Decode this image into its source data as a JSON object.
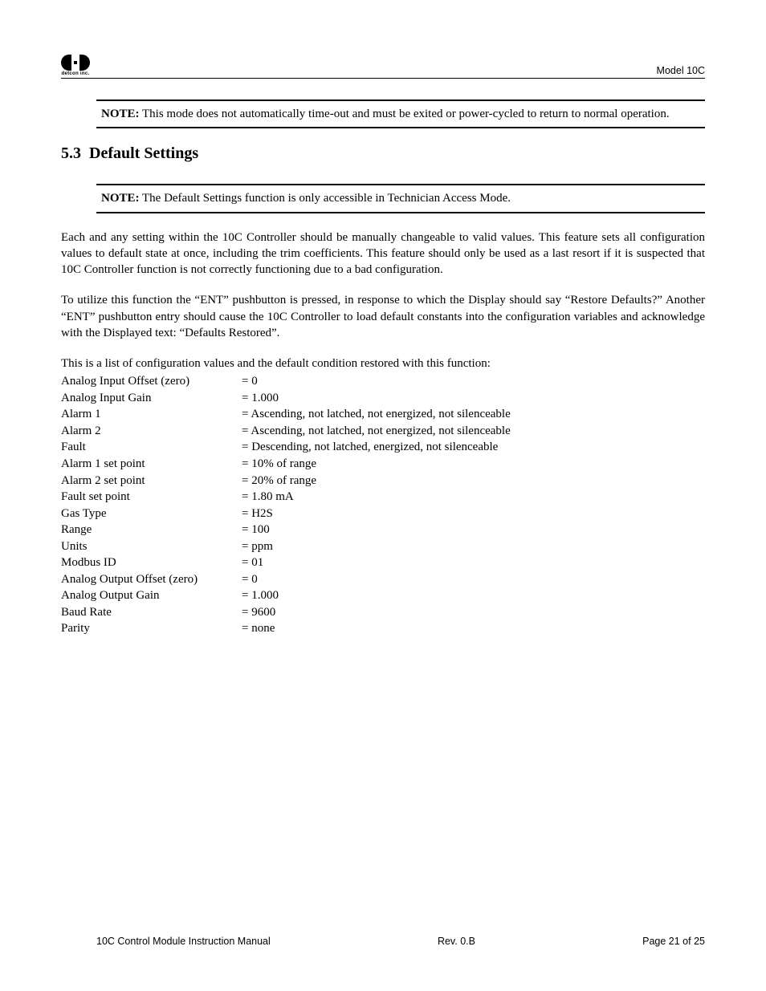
{
  "header": {
    "logo_text": "detcon inc.",
    "model": "Model 10C"
  },
  "note1": {
    "label": "NOTE:",
    "text": "This mode does not automatically time-out and must be exited or power-cycled to return to normal operation."
  },
  "section": {
    "number": "5.3",
    "title": "Default Settings"
  },
  "note2": {
    "label": "NOTE:",
    "text": "The Default Settings function is only accessible in Technician Access Mode."
  },
  "para1": "Each and any setting within the 10C Controller should be manually changeable to valid values.  This feature sets all configuration values to default state at once, including the trim coefficients.  This feature should only be used as a last resort if it is suspected that 10C Controller function is not correctly functioning due to a bad configuration.",
  "para2": "To utilize this function the “ENT” pushbutton is pressed, in response to which the Display should say “Restore Defaults?”  Another “ENT” pushbutton entry should cause the 10C Controller to load default constants into the configuration variables and acknowledge with the Displayed text:  “Defaults Restored”.",
  "list_intro": "This is a list of configuration values and the default condition restored with this function:",
  "settings": [
    {
      "label": "Analog Input Offset (zero)",
      "value": "= 0"
    },
    {
      "label": "Analog Input Gain",
      "value": "= 1.000"
    },
    {
      "label": "Alarm 1",
      "value": "= Ascending, not latched, not energized, not silenceable"
    },
    {
      "label": "Alarm 2",
      "value": "= Ascending, not latched, not energized, not silenceable"
    },
    {
      "label": "Fault",
      "value": "= Descending, not latched, energized, not silenceable"
    },
    {
      "label": "Alarm 1 set point",
      "value": "= 10% of range"
    },
    {
      "label": "Alarm 2 set point",
      "value": "= 20% of range"
    },
    {
      "label": "Fault set point",
      "value": "= 1.80 mA"
    },
    {
      "label": "Gas Type",
      "value": "= H2S"
    },
    {
      "label": "Range",
      "value": "= 100"
    },
    {
      "label": "Units",
      "value": "= ppm"
    },
    {
      "label": "Modbus ID",
      "value": "= 01"
    },
    {
      "label": "Analog Output Offset (zero)",
      "value": "= 0"
    },
    {
      "label": "Analog Output Gain",
      "value": "= 1.000"
    },
    {
      "label": "Baud Rate",
      "value": "= 9600"
    },
    {
      "label": "Parity",
      "value": "= none"
    }
  ],
  "footer": {
    "left": "10C Control Module Instruction Manual",
    "center": "Rev. 0.B",
    "right": "Page 21 of 25"
  }
}
